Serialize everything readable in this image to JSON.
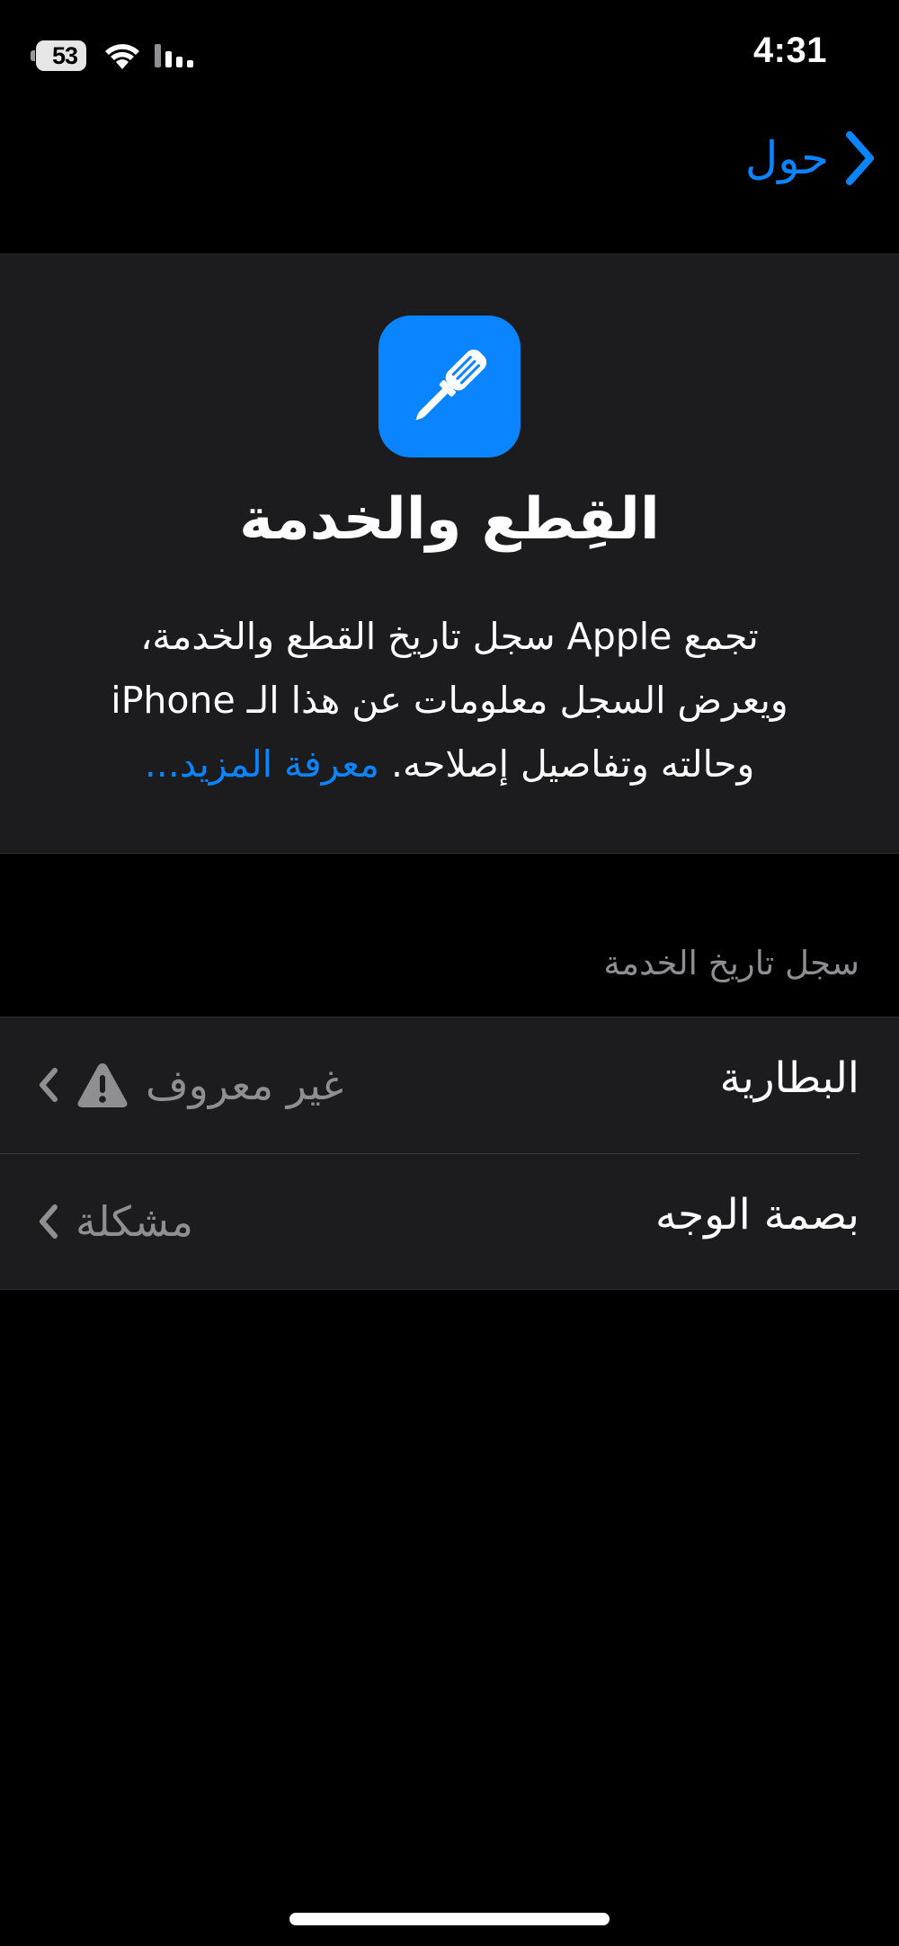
{
  "status_bar": {
    "battery_level": "53",
    "time": "4:31",
    "icons": [
      "battery-icon",
      "wifi-icon",
      "cellular-signal-icon"
    ]
  },
  "nav": {
    "back_label": "حول",
    "back_icon": "chevron-right-icon"
  },
  "header": {
    "icon": "screwdriver-icon",
    "title": "القِطع والخدمة",
    "description_line1": "تجمع Apple سجل تاريخ القطع والخدمة،",
    "description_line2": "ويعرض السجل معلومات عن هذا الـ iPhone",
    "description_line3": "وحالته وتفاصيل إصلاحه.",
    "learn_more": "معرفة المزيد..."
  },
  "service_history": {
    "section_title": "سجل تاريخ الخدمة",
    "rows": [
      {
        "title": "البطارية",
        "value": "غير معروف",
        "icon": "warning-icon"
      },
      {
        "title": "بصمة الوجه",
        "value": "مشكلة"
      }
    ]
  },
  "colors": {
    "background": "#000000",
    "grouped_surface": "#1c1c1e",
    "accent": "#0a84ff",
    "secondary_text": "#8e8e93",
    "separator": "#3a3a3c"
  }
}
